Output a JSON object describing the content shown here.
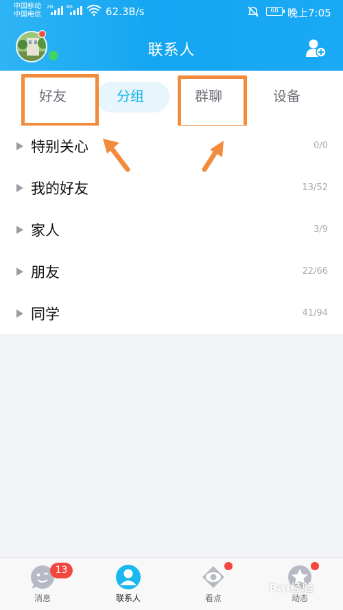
{
  "status_bar": {
    "carrier_1": "中国移动",
    "carrier_2": "中国电信",
    "net_1": "2G",
    "net_2": "4G",
    "speed": "62.3B/s",
    "battery": "68",
    "time": "晚上7:05",
    "icons": [
      "signal-icon",
      "wifi-icon",
      "mute-bell-icon",
      "battery-icon"
    ]
  },
  "header": {
    "title": "联系人",
    "add_contact_icon": "add-contact-icon"
  },
  "tabs": [
    {
      "label": "好友",
      "highlighted": true
    },
    {
      "label": "分组",
      "selected": true
    },
    {
      "label": "群聊",
      "highlighted": true
    },
    {
      "label": "设备"
    }
  ],
  "groups": [
    {
      "name": "特别关心",
      "count": "0/0"
    },
    {
      "name": "我的好友",
      "count": "13/52"
    },
    {
      "name": "家人",
      "count": "3/9"
    },
    {
      "name": "朋友",
      "count": "22/66"
    },
    {
      "name": "同学",
      "count": "41/94"
    }
  ],
  "bottom_nav": {
    "items": [
      {
        "label": "消息",
        "icon": "message-icon",
        "badge": "13"
      },
      {
        "label": "联系人",
        "icon": "contacts-icon",
        "active": true
      },
      {
        "label": "看点",
        "icon": "eye-icon",
        "dot": true
      },
      {
        "label": "动态",
        "icon": "star-icon",
        "dot": true
      }
    ]
  },
  "watermark": "Bai经验",
  "colors": {
    "accent": "#15b5ec",
    "highlight": "#f28b3c",
    "badge": "#f2473f"
  }
}
